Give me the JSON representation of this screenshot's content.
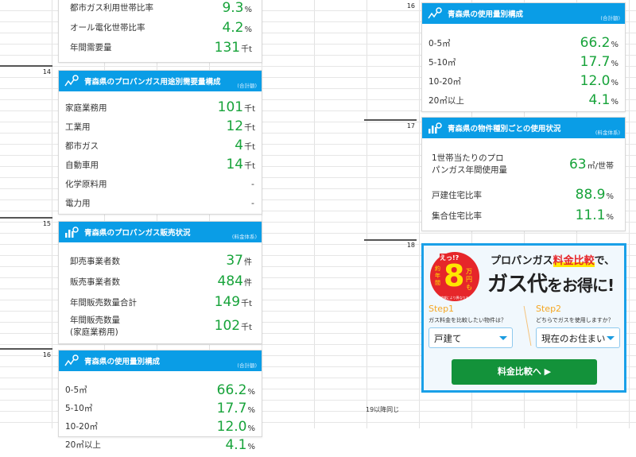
{
  "rows": {
    "r14": "14",
    "r15": "15",
    "r16a": "16",
    "r16b": "16",
    "r17": "17",
    "r18": "18"
  },
  "note": "19以降同じ",
  "card_top": {
    "items": [
      {
        "label": "都市ガス利用世帯比率",
        "value": "9.3",
        "unit": "%"
      },
      {
        "label": "オール電化世帯比率",
        "value": "4.2",
        "unit": "%"
      },
      {
        "label": "年間需要量",
        "value": "131",
        "unit": "千t"
      }
    ]
  },
  "card_usage": {
    "title": "青森県のプロパンガス用途別需要量構成",
    "sub": "(合計額)",
    "icon": "line-chart-search-icon",
    "items": [
      {
        "label": "家庭業務用",
        "value": "101",
        "unit": "千t"
      },
      {
        "label": "工業用",
        "value": "12",
        "unit": "千t"
      },
      {
        "label": "都市ガス",
        "value": "4",
        "unit": "千t"
      },
      {
        "label": "自動車用",
        "value": "14",
        "unit": "千t"
      },
      {
        "label": "化学原料用",
        "value": "-",
        "unit": ""
      },
      {
        "label": "電力用",
        "value": "-",
        "unit": ""
      }
    ]
  },
  "card_sales": {
    "title": "青森県のプロパンガス販売状況",
    "sub": "(料金体系)",
    "icon": "bar-chart-search-icon",
    "items": [
      {
        "label": "卸売事業者数",
        "value": "37",
        "unit": "件"
      },
      {
        "label": "販売事業者数",
        "value": "484",
        "unit": "件"
      },
      {
        "label": "年間販売数量合計",
        "value": "149",
        "unit": "千t"
      },
      {
        "label": "年間販売数量\n(家庭業務用)",
        "value": "102",
        "unit": "千t"
      }
    ]
  },
  "card_volume": {
    "title": "青森県の使用量別構成",
    "sub": "(合計額)",
    "icon": "line-chart-search-icon",
    "items": [
      {
        "label": "0-5㎥",
        "value": "66.2",
        "unit": "%"
      },
      {
        "label": "5-10㎥",
        "value": "17.7",
        "unit": "%"
      },
      {
        "label": "10-20㎥",
        "value": "12.0",
        "unit": "%"
      },
      {
        "label": "20㎥以上",
        "value": "4.1",
        "unit": "%"
      }
    ]
  },
  "card_property": {
    "title": "青森県の物件種別ごとの使用状況",
    "sub": "(料金体系)",
    "icon": "bar-chart-search-icon",
    "items": [
      {
        "label": "1世帯当たりのプロパンガス年間使用量",
        "value": "63",
        "unit": "㎥/世帯"
      },
      {
        "label": "戸建住宅比率",
        "value": "88.9",
        "unit": "%"
      },
      {
        "label": "集合住宅比率",
        "value": "11.1",
        "unit": "%"
      }
    ]
  },
  "ad": {
    "badge_top": "えっ!?",
    "badge_side": "約年間",
    "badge_num": "8",
    "badge_unit": "万円も",
    "badge_note": "※地域により異なります",
    "headline_pre": "プロパンガス",
    "headline_hl": "料金比較",
    "headline_post": "で、",
    "big": "ガス代",
    "big2": "をお得に!",
    "step1": "Step1",
    "step1_q": "ガス料金を比較したい物件は？",
    "step1_val": "戸建て",
    "step2": "Step2",
    "step2_q": "どちらでガスを使用しますか？",
    "step2_val": "現在のお住まい",
    "cta": "料金比較へ ▶",
    "accent": "#1aa0e8",
    "cta_color": "#13923a"
  }
}
